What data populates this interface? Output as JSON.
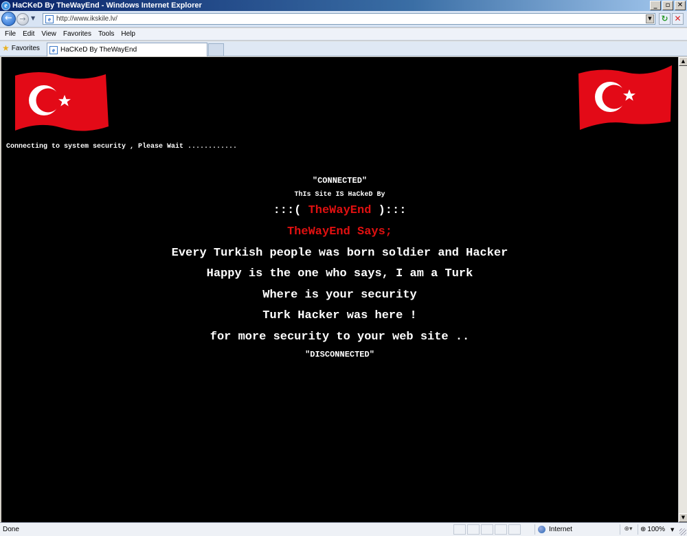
{
  "window": {
    "title": "HaCKeD By TheWayEnd - Windows Internet Explorer",
    "buttons": {
      "minimize": "_",
      "maximize": "▫",
      "close": "✕"
    }
  },
  "address": {
    "url": "http://www.ikskile.lv/"
  },
  "menu": {
    "items": [
      "File",
      "Edit",
      "View",
      "Favorites",
      "Tools",
      "Help"
    ]
  },
  "tabs": {
    "favorites_label": "Favorites",
    "active_tab_title": "HaCKeD By TheWayEnd"
  },
  "page": {
    "connecting": "Connecting to system security , Please Wait ............",
    "connected": "\"CONNECTED\"",
    "hacked_by": "ThIs Site IS HaCkeD By",
    "handle_prefix": ":::( ",
    "handle": "TheWayEnd",
    "handle_suffix": " ):::",
    "says": "TheWayEnd Says;",
    "lines": [
      "Every Turkish people was born soldier and Hacker",
      "Happy is the one who says, I am a Turk",
      "Where is your security",
      "Turk Hacker was here !",
      "for more security to your web site .."
    ],
    "disconnected": "\"DISCONNECTED\""
  },
  "status": {
    "text": "Done",
    "zone": "Internet",
    "zoom": "100%"
  },
  "colors": {
    "page_background": "#000000",
    "text": "#ffffff",
    "accent_red": "#e01010",
    "flag_red": "#e30a17"
  },
  "icons": {
    "app": "ie-icon",
    "back": "back-arrow-icon",
    "forward": "forward-arrow-icon",
    "refresh": "refresh-icon",
    "stop": "stop-icon",
    "favorites": "star-icon",
    "zone": "globe-icon",
    "zoom": "magnifier-icon"
  }
}
